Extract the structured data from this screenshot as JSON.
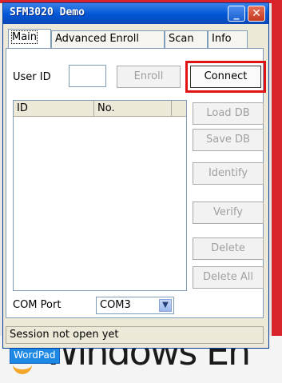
{
  "window": {
    "title": "SFM3020 Demo",
    "min_glyph": "_",
    "close_glyph": "✕"
  },
  "tabs": [
    "Main",
    "Advanced Enroll",
    "Scan",
    "Info"
  ],
  "main": {
    "user_id_label": "User ID",
    "user_id_value": "",
    "enroll_button": "Enroll",
    "connect_button": "Connect",
    "list_columns": [
      "ID",
      "No."
    ],
    "buttons": [
      "Load DB",
      "Save DB",
      "Identify",
      "Verify",
      "Delete",
      "Delete All"
    ],
    "com_port_label": "COM Port",
    "com_port_value": "COM3",
    "status": "Session not open yet"
  },
  "desktop": {
    "text": "Windows En",
    "wordpad_label": "WordPad"
  },
  "colors": {
    "accent_red": "#d8232a",
    "highlight_red": "#e01414",
    "titlebar_blue": "#0056d6"
  }
}
